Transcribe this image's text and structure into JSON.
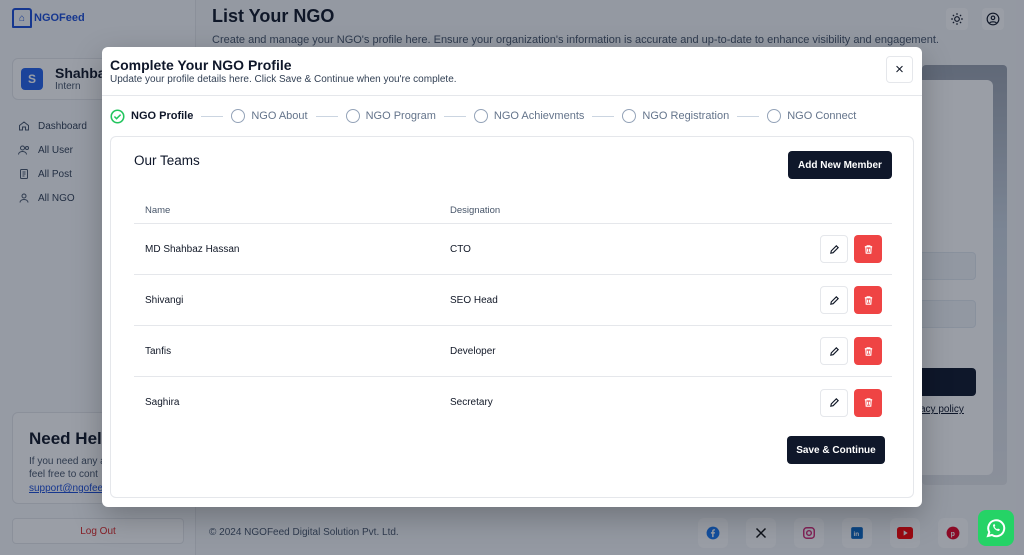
{
  "app": {
    "logo_text": "NGOFeed",
    "user": {
      "initial": "S",
      "name": "Shahba",
      "role": "Intern"
    },
    "nav": [
      {
        "label": "Dashboard",
        "icon": "home-icon"
      },
      {
        "label": "All User",
        "icon": "users-icon"
      },
      {
        "label": "All Post",
        "icon": "document-icon"
      },
      {
        "label": "All NGO",
        "icon": "user-icon"
      }
    ],
    "help": {
      "title": "Need Help",
      "text_line1": "If you need any a",
      "text_line2": "feel free to cont",
      "email": "support@ngofee"
    },
    "logout_label": "Log Out",
    "page_title": "List Your NGO",
    "page_subtitle": "Create and manage your NGO's profile here. Ensure your organization's information is accurate and up-to-date to enhance visibility and engagement.",
    "privacy_text": "acy policy",
    "footer": "© 2024 NGOFeed Digital Solution Pvt. Ltd.",
    "socials": [
      "facebook-icon",
      "x-icon",
      "instagram-icon",
      "linkedin-icon",
      "youtube-icon",
      "pinterest-icon"
    ]
  },
  "modal": {
    "title": "Complete Your NGO Profile",
    "subtitle": "Update your profile details here. Click Save & Continue when you're complete.",
    "close_symbol": "×",
    "steps": [
      {
        "label": "NGO Profile",
        "done": true
      },
      {
        "label": "NGO About",
        "done": false
      },
      {
        "label": "NGO Program",
        "done": false
      },
      {
        "label": "NGO Achievments",
        "done": false
      },
      {
        "label": "NGO Registration",
        "done": false
      },
      {
        "label": "NGO Connect",
        "done": false
      }
    ],
    "section_title": "Our Teams",
    "add_button": "Add New Member",
    "columns": {
      "name": "Name",
      "designation": "Designation"
    },
    "members": [
      {
        "name": "MD Shahbaz Hassan",
        "designation": "CTO"
      },
      {
        "name": "Shivangi",
        "designation": "SEO Head"
      },
      {
        "name": "Tanfis",
        "designation": "Developer"
      },
      {
        "name": "Saghira",
        "designation": "Secretary"
      }
    ],
    "save_button": "Save & Continue"
  },
  "colors": {
    "primary": "#0f172a",
    "danger": "#ef4444",
    "success": "#22c55e",
    "brand": "#1d4ed8"
  }
}
